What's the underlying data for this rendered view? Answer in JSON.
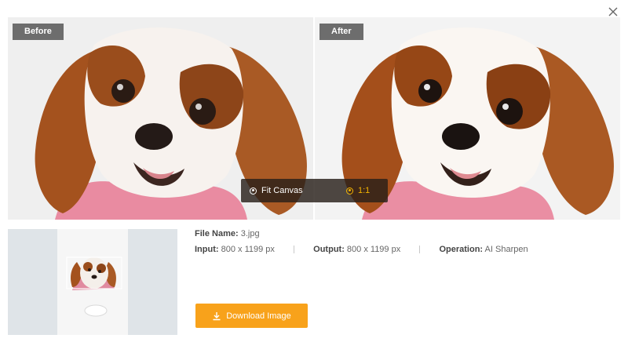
{
  "dialog": {
    "close_icon": "close-icon"
  },
  "compare": {
    "before_label": "Before",
    "after_label": "After",
    "view_options": [
      {
        "label": "Fit Canvas",
        "selected": false
      },
      {
        "label": "1:1",
        "selected": true
      }
    ]
  },
  "file_info": {
    "name_label": "File Name:",
    "name_value": "3.jpg",
    "input_label": "Input:",
    "input_value": "800 x 1199 px",
    "output_label": "Output:",
    "output_value": "800 x 1199 px",
    "operation_label": "Operation:",
    "operation_value": "AI Sharpen"
  },
  "download": {
    "label": "Download Image",
    "icon": "download-icon"
  },
  "colors": {
    "accent": "#f8a21b",
    "selected_option": "#f4b400"
  }
}
